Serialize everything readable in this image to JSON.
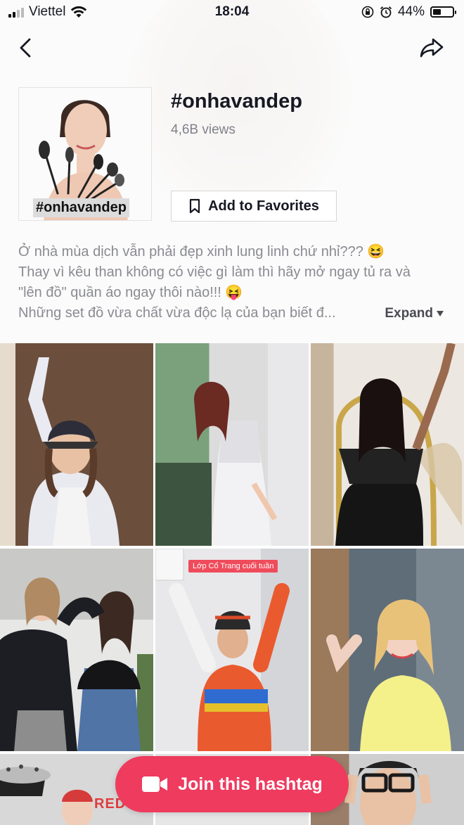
{
  "status_bar": {
    "carrier": "Viettel",
    "time": "18:04",
    "battery": "44%",
    "battery_level": 0.44
  },
  "hashtag": {
    "thumbnail_caption": "#onhavandep",
    "title": "#onhavandep",
    "views": "4,6B views",
    "favorites_label": "Add to Favorites"
  },
  "description": {
    "lines": [
      "Ở nhà mùa dịch vẫn phải đẹp xinh lung linh chứ nhỉ??? 😆",
      "Thay vì kêu than không có việc gì làm thì hãy mở ngay tủ ra và",
      "\"lên đồ\" quần áo ngay thôi nào!!! 😝",
      "Những set đồ vừa chất vừa độc lạ của bạn biết đ..."
    ],
    "expand_label": "Expand"
  },
  "videos": {
    "overlay_label": "Lớp Cổ Trang cuối tuần",
    "bottom_text": "RED"
  },
  "join_button": {
    "label": "Join this hashtag"
  }
}
